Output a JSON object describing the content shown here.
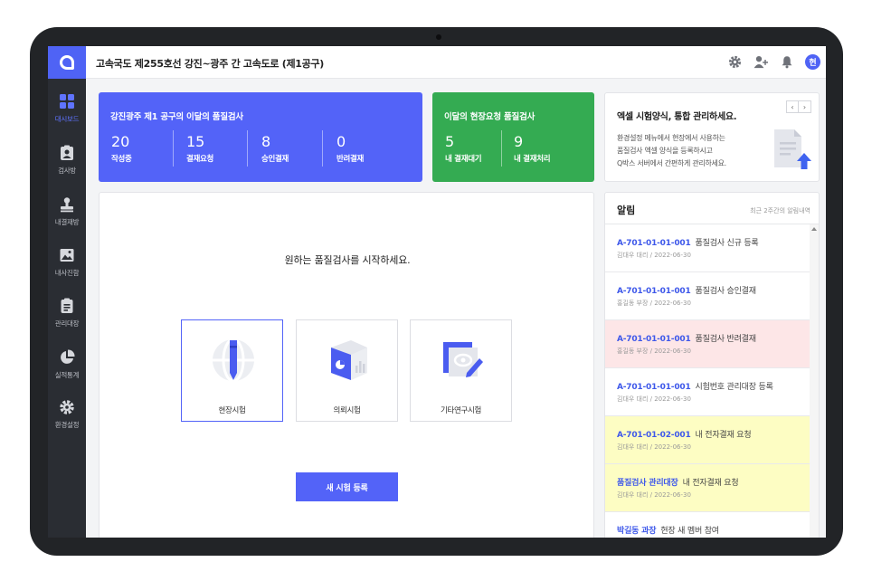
{
  "app": {
    "project_title": "고속국도 제255호선 강진~광주 간 고속도로 (제1공구)",
    "avatar_initial": "현",
    "colors": {
      "primary": "#5363f8",
      "green": "#34ab52",
      "sidebar": "#2a2d33",
      "pink_row": "#fde6e7",
      "yellow_row": "#fdfdc3"
    }
  },
  "sidebar": {
    "items": [
      {
        "label": "대시보드",
        "icon": "dashboard-grid-icon"
      },
      {
        "label": "검사방",
        "icon": "clipboard-user-icon"
      },
      {
        "label": "내결재방",
        "icon": "stamp-icon"
      },
      {
        "label": "내사진함",
        "icon": "image-icon"
      },
      {
        "label": "관리대장",
        "icon": "clipboard-list-icon"
      },
      {
        "label": "실적통계",
        "icon": "pie-chart-icon"
      },
      {
        "label": "환경설정",
        "icon": "gear-icon"
      }
    ]
  },
  "topbar": {
    "icons": [
      "gear-icon",
      "add-user-icon",
      "bell-icon"
    ]
  },
  "summary_card": {
    "title": "강진광주 제1 공구의 이달의 품질검사",
    "stats": [
      {
        "value": "20",
        "label": "작성중"
      },
      {
        "value": "15",
        "label": "결재요청"
      },
      {
        "value": "8",
        "label": "승인결재"
      },
      {
        "value": "0",
        "label": "반려결재"
      }
    ]
  },
  "field_card": {
    "title": "이달의 현장요청 품질검사",
    "stats": [
      {
        "value": "5",
        "label": "내 결재대기"
      },
      {
        "value": "9",
        "label": "내 결재처리"
      }
    ]
  },
  "promo": {
    "title": "엑셀 시험양식, 통합 관리하세요.",
    "line1": "환경설정 메뉴에서 현장에서 사용하는",
    "line2": "품질검사 엑셀 양식을 등록하시고",
    "line3": "Q박스 서버에서 간편하게 관리하세요.",
    "prev": "‹",
    "next": "›"
  },
  "main": {
    "prompt": "원하는 품질검사를 시작하세요.",
    "tests": [
      {
        "label": "현장시험",
        "icon": "pen-globe-icon"
      },
      {
        "label": "의뢰시험",
        "icon": "box-chart-icon"
      },
      {
        "label": "기타연구시험",
        "icon": "document-edit-icon"
      }
    ],
    "new_button": "새 시험 등록"
  },
  "notifications": {
    "title": "알림",
    "subtitle": "최근 2주간의 알림내역",
    "items": [
      {
        "code": "A-701-01-01-001",
        "text": "품질검사 신규 등록",
        "meta": "김대우 대리 / 2022-06-30",
        "status": "normal"
      },
      {
        "code": "A-701-01-01-001",
        "text": "품질검사 승인결재",
        "meta": "홍길동 부장 / 2022-06-30",
        "status": "normal"
      },
      {
        "code": "A-701-01-01-001",
        "text": "품질검사 반려결재",
        "meta": "홍길동 부장 / 2022-06-30",
        "status": "rejected"
      },
      {
        "code": "A-701-01-01-001",
        "text": "시험번호 관리대장 등록",
        "meta": "김대우 대리 / 2022-06-30",
        "status": "normal"
      },
      {
        "code": "A-701-01-02-001",
        "text": "내 전자결재 요청",
        "meta": "김대우 대리 / 2022-06-30",
        "status": "pending"
      },
      {
        "code": "품질검사 관리대장",
        "text": "내 전자결재 요청",
        "meta": "김대우 대리 / 2022-06-30",
        "status": "pending"
      },
      {
        "code": "박길동 과장",
        "text": "현장 새 멤버 참여",
        "meta": "",
        "status": "normal"
      }
    ]
  }
}
